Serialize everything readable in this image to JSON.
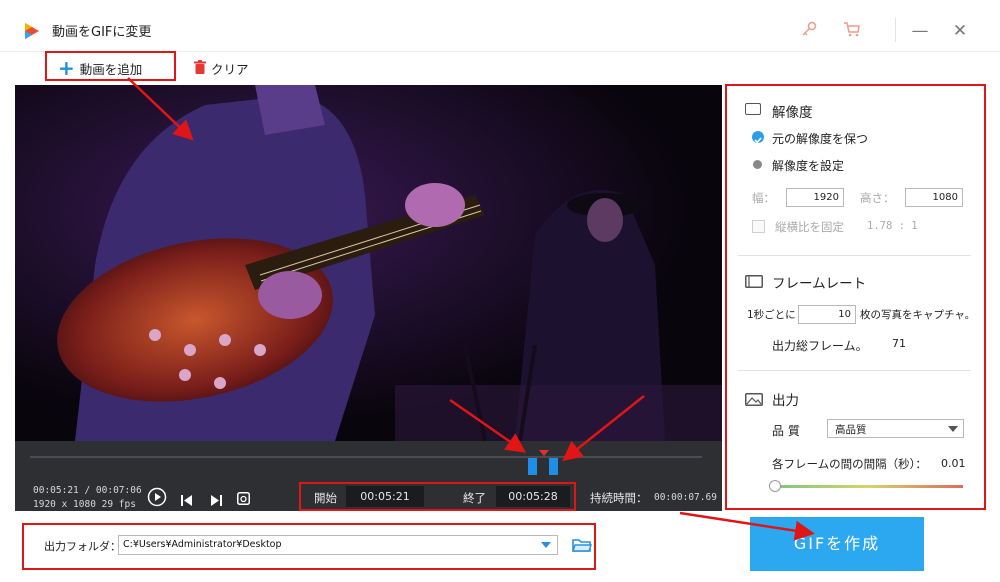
{
  "app": {
    "title": "動画をGIFに変更"
  },
  "window_controls": {
    "minimize": "—",
    "close": "✕"
  },
  "toolbar": {
    "add_video": "動画を追加",
    "clear": "クリア"
  },
  "player": {
    "position": "00:05:21 / 00:07:06",
    "meta": "1920 x 1080   29 fps",
    "start_label": "開始",
    "start_time": "00:05:21",
    "end_label": "終了",
    "end_time": "00:05:28",
    "duration_label": "持続時間：",
    "duration": "00:00:07.69"
  },
  "resolution": {
    "title": "解像度",
    "keep_original": "元の解像度を保つ",
    "set_resolution": "解像度を設定",
    "width_label": "幅：",
    "width_value": "1920",
    "height_label": "高さ：",
    "height_value": "1080",
    "aspect_label": "縦横比を固定",
    "aspect_value": "1.78 : 1"
  },
  "framerate": {
    "title": "フレームレート",
    "prefix": "1秒ごとに",
    "value": "10",
    "suffix": "枚の写真をキャプチャ。",
    "total_label": "出力総フレーム。",
    "total_value": "71"
  },
  "output": {
    "title": "出力",
    "quality_label": "品 質",
    "quality_value": "高品質",
    "interval_label": "各フレームの間の間隔（秒）：",
    "interval_value": "0.01",
    "interval_slider_level": 0.0
  },
  "bottom": {
    "folder_label": "出力フォルダ：",
    "folder_path": "C:¥Users¥Administrator¥Desktop",
    "create_gif": "GIFを作成"
  },
  "colors": {
    "accent": "#2ca8f0",
    "annotation": "#e01515",
    "handle": "#1f8ee8"
  }
}
